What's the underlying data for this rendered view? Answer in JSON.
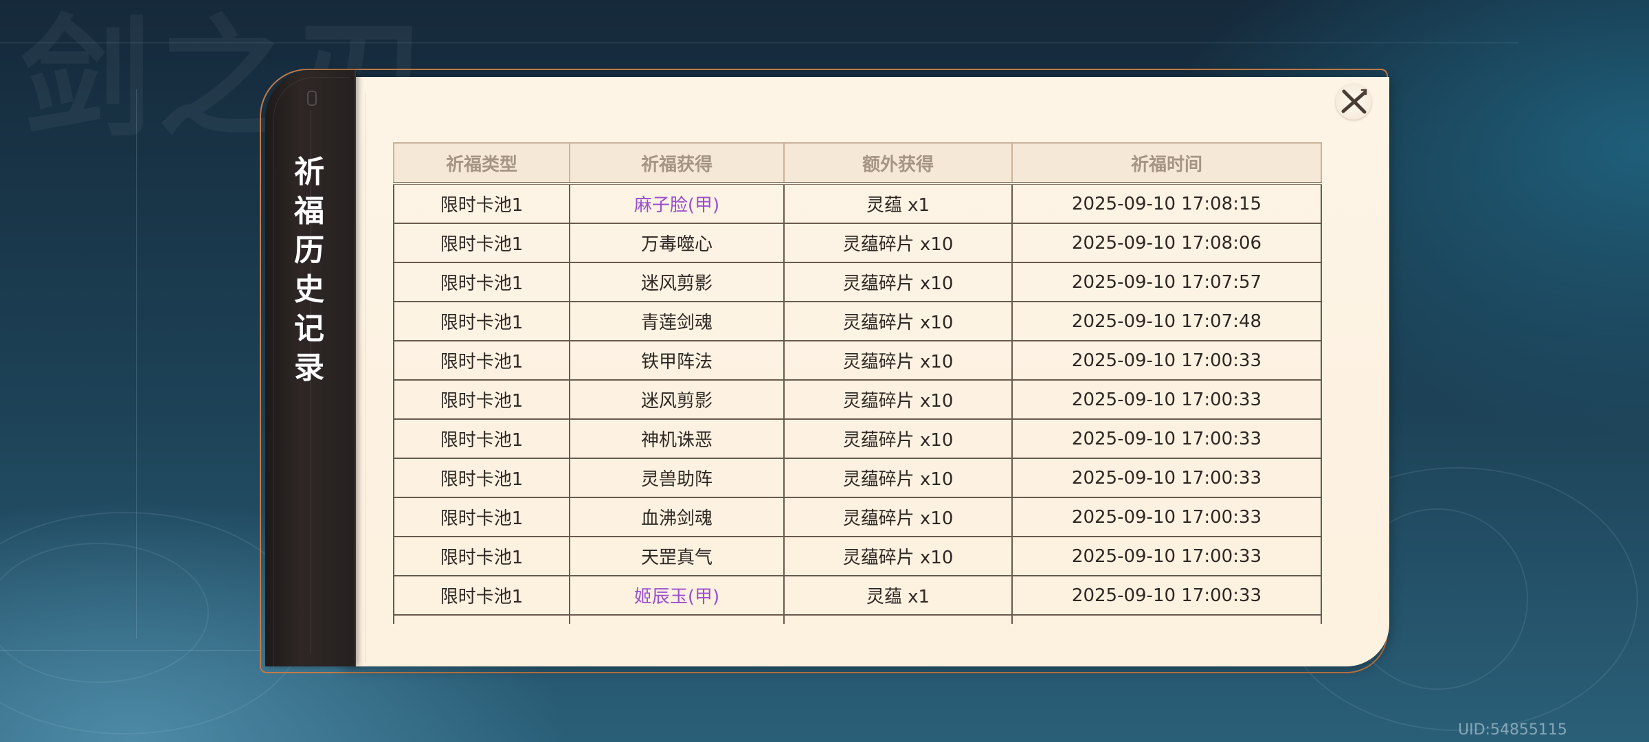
{
  "window": {
    "title": "祈福历史记录"
  },
  "background": {
    "calligraphy": "剑之刃"
  },
  "table": {
    "headers": [
      "祈福类型",
      "祈福获得",
      "额外获得",
      "祈福时间"
    ],
    "rows": [
      {
        "type": "限时卡池1",
        "obtained": "麻子脸(甲)",
        "extra": "灵蕴 x1",
        "time": "2025-09-10 17:08:15",
        "rare": true
      },
      {
        "type": "限时卡池1",
        "obtained": "万毒噬心",
        "extra": "灵蕴碎片 x10",
        "time": "2025-09-10 17:08:06",
        "rare": false
      },
      {
        "type": "限时卡池1",
        "obtained": "迷风剪影",
        "extra": "灵蕴碎片 x10",
        "time": "2025-09-10 17:07:57",
        "rare": false
      },
      {
        "type": "限时卡池1",
        "obtained": "青莲剑魂",
        "extra": "灵蕴碎片 x10",
        "time": "2025-09-10 17:07:48",
        "rare": false
      },
      {
        "type": "限时卡池1",
        "obtained": "铁甲阵法",
        "extra": "灵蕴碎片 x10",
        "time": "2025-09-10 17:00:33",
        "rare": false
      },
      {
        "type": "限时卡池1",
        "obtained": "迷风剪影",
        "extra": "灵蕴碎片 x10",
        "time": "2025-09-10 17:00:33",
        "rare": false
      },
      {
        "type": "限时卡池1",
        "obtained": "神机诛恶",
        "extra": "灵蕴碎片 x10",
        "time": "2025-09-10 17:00:33",
        "rare": false
      },
      {
        "type": "限时卡池1",
        "obtained": "灵兽助阵",
        "extra": "灵蕴碎片 x10",
        "time": "2025-09-10 17:00:33",
        "rare": false
      },
      {
        "type": "限时卡池1",
        "obtained": "血沸剑魂",
        "extra": "灵蕴碎片 x10",
        "time": "2025-09-10 17:00:33",
        "rare": false
      },
      {
        "type": "限时卡池1",
        "obtained": "天罡真气",
        "extra": "灵蕴碎片 x10",
        "time": "2025-09-10 17:00:33",
        "rare": false
      },
      {
        "type": "限时卡池1",
        "obtained": "姬辰玉(甲)",
        "extra": "灵蕴 x1",
        "time": "2025-09-10 17:00:33",
        "rare": true
      }
    ]
  },
  "footer": {
    "uid": "UID:54855115"
  },
  "colors": {
    "rare_text": "#9a4fd0",
    "panel_bg": "#fdf4e6",
    "tab_bg": "#2e2726",
    "frame_accent": "#c47a45"
  },
  "icons": {
    "close": "close-x-icon"
  }
}
